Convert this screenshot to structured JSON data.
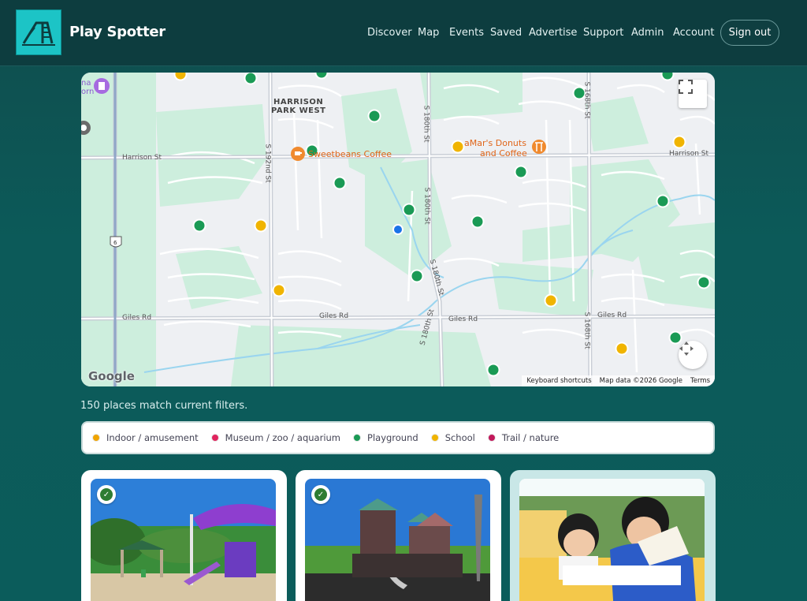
{
  "header": {
    "brand": "Play Spotter",
    "nav": [
      "Discover",
      "Map",
      "Events",
      "Saved",
      "Advertise",
      "Support",
      "Admin",
      "Account"
    ],
    "sign_out": "Sign out"
  },
  "map": {
    "area_label_1": "HARRISON",
    "area_label_2": "PARK WEST",
    "streets": {
      "harrison_left": "Harrison St",
      "harrison_right": "Harrison St",
      "giles_left": "Giles Rd",
      "giles_mid1": "Giles Rd",
      "giles_mid2": "Giles Rd",
      "giles_right": "Giles Rd",
      "s192": "S 192nd St",
      "s180a": "S 180th St",
      "s180b": "S 180th St",
      "s180c": "S 180th St",
      "s180d": "S 180th St",
      "s168a": "S 168th St",
      "s168b": "S 168th St",
      "hwy": "6"
    },
    "pois": {
      "coffee_1": "Sweetbeans Coffee",
      "coffee_2_line1": "aMar's Donuts",
      "coffee_2_line2": "and Coffee",
      "partial_top_left_1": "na",
      "partial_top_left_2": "orn"
    },
    "google": "Google",
    "footer": {
      "shortcuts": "Keyboard shortcuts",
      "data": "Map data ©2026 Google",
      "terms": "Terms"
    },
    "marker_colors": {
      "playground": "#1a9a55",
      "school": "#f0b400",
      "me": "#1a73e8"
    }
  },
  "results": {
    "count_text": "150 places match current filters."
  },
  "legend": [
    {
      "label": "Indoor / amusement",
      "color": "#f0a400"
    },
    {
      "label": "Museum / zoo / aquarium",
      "color": "#e0245e"
    },
    {
      "label": "Playground",
      "color": "#1a9a55"
    },
    {
      "label": "School",
      "color": "#f0b400"
    },
    {
      "label": "Trail / nature",
      "color": "#c2185b"
    }
  ]
}
